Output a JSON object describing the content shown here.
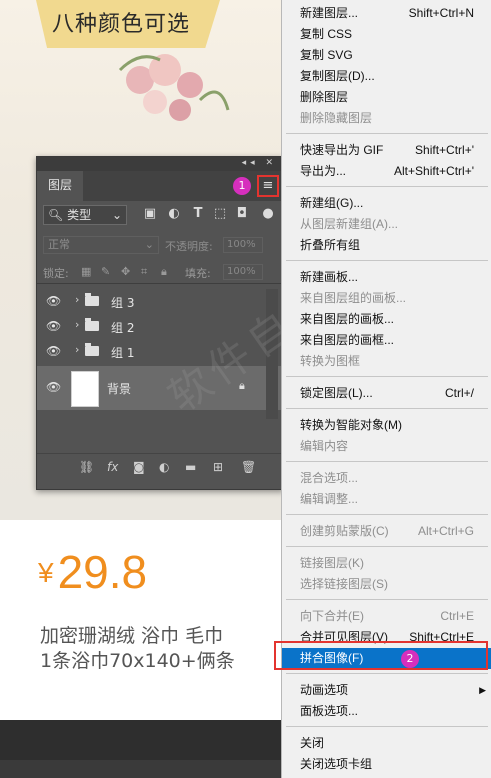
{
  "product": {
    "banner": "八种颜色可选",
    "price_symbol": "¥",
    "price": "29.8",
    "desc_line1": "加密珊湖绒 浴巾 毛巾 ",
    "desc_line2": "1条浴巾70x140+俩条"
  },
  "watermark": "软件自学网",
  "panel": {
    "tab": "图层",
    "filter": "类型",
    "blend_mode": "正常",
    "opacity_label": "不透明度:",
    "opacity_value": "100%",
    "lock_label": "锁定:",
    "fill_label": "填充:",
    "fill_value": "100%",
    "layers": [
      {
        "name": "组 3",
        "type": "group"
      },
      {
        "name": "组 2",
        "type": "group"
      },
      {
        "name": "组 1",
        "type": "group"
      },
      {
        "name": "背景",
        "type": "background"
      }
    ],
    "badge1": "1"
  },
  "menu": {
    "items": [
      {
        "label": "新建图层...",
        "shortcut": "Shift+Ctrl+N",
        "enabled": true
      },
      {
        "label": "复制 CSS",
        "shortcut": "",
        "enabled": true
      },
      {
        "label": "复制 SVG",
        "shortcut": "",
        "enabled": true
      },
      {
        "label": "复制图层(D)...",
        "shortcut": "",
        "enabled": true
      },
      {
        "label": "删除图层",
        "shortcut": "",
        "enabled": true
      },
      {
        "label": "删除隐藏图层",
        "shortcut": "",
        "enabled": false
      },
      {
        "label": "快速导出为 GIF",
        "shortcut": "Shift+Ctrl+'",
        "enabled": true
      },
      {
        "label": "导出为...",
        "shortcut": "Alt+Shift+Ctrl+'",
        "enabled": true
      },
      {
        "label": "新建组(G)...",
        "shortcut": "",
        "enabled": true
      },
      {
        "label": "从图层新建组(A)...",
        "shortcut": "",
        "enabled": false
      },
      {
        "label": "折叠所有组",
        "shortcut": "",
        "enabled": true
      },
      {
        "label": "新建画板...",
        "shortcut": "",
        "enabled": true
      },
      {
        "label": "来自图层组的画板...",
        "shortcut": "",
        "enabled": false
      },
      {
        "label": "来自图层的画板...",
        "shortcut": "",
        "enabled": true
      },
      {
        "label": "来自图层的画框...",
        "shortcut": "",
        "enabled": true
      },
      {
        "label": "转换为图框",
        "shortcut": "",
        "enabled": false
      },
      {
        "label": "锁定图层(L)...",
        "shortcut": "Ctrl+/",
        "enabled": true
      },
      {
        "label": "转换为智能对象(M)",
        "shortcut": "",
        "enabled": true
      },
      {
        "label": "编辑内容",
        "shortcut": "",
        "enabled": false
      },
      {
        "label": "混合选项...",
        "shortcut": "",
        "enabled": false
      },
      {
        "label": "编辑调整...",
        "shortcut": "",
        "enabled": false
      },
      {
        "label": "创建剪贴蒙版(C)",
        "shortcut": "Alt+Ctrl+G",
        "enabled": false
      },
      {
        "label": "链接图层(K)",
        "shortcut": "",
        "enabled": false
      },
      {
        "label": "选择链接图层(S)",
        "shortcut": "",
        "enabled": false
      },
      {
        "label": "向下合并(E)",
        "shortcut": "Ctrl+E",
        "enabled": false
      },
      {
        "label": "合并可见图层(V)",
        "shortcut": "Shift+Ctrl+E",
        "enabled": true
      },
      {
        "label": "拼合图像(F)",
        "shortcut": "",
        "enabled": true
      },
      {
        "label": "动画选项",
        "shortcut": "",
        "enabled": true
      },
      {
        "label": "面板选项...",
        "shortcut": "",
        "enabled": true
      },
      {
        "label": "关闭",
        "shortcut": "",
        "enabled": true
      },
      {
        "label": "关闭选项卡组",
        "shortcut": "",
        "enabled": true
      }
    ],
    "badge2": "2"
  }
}
